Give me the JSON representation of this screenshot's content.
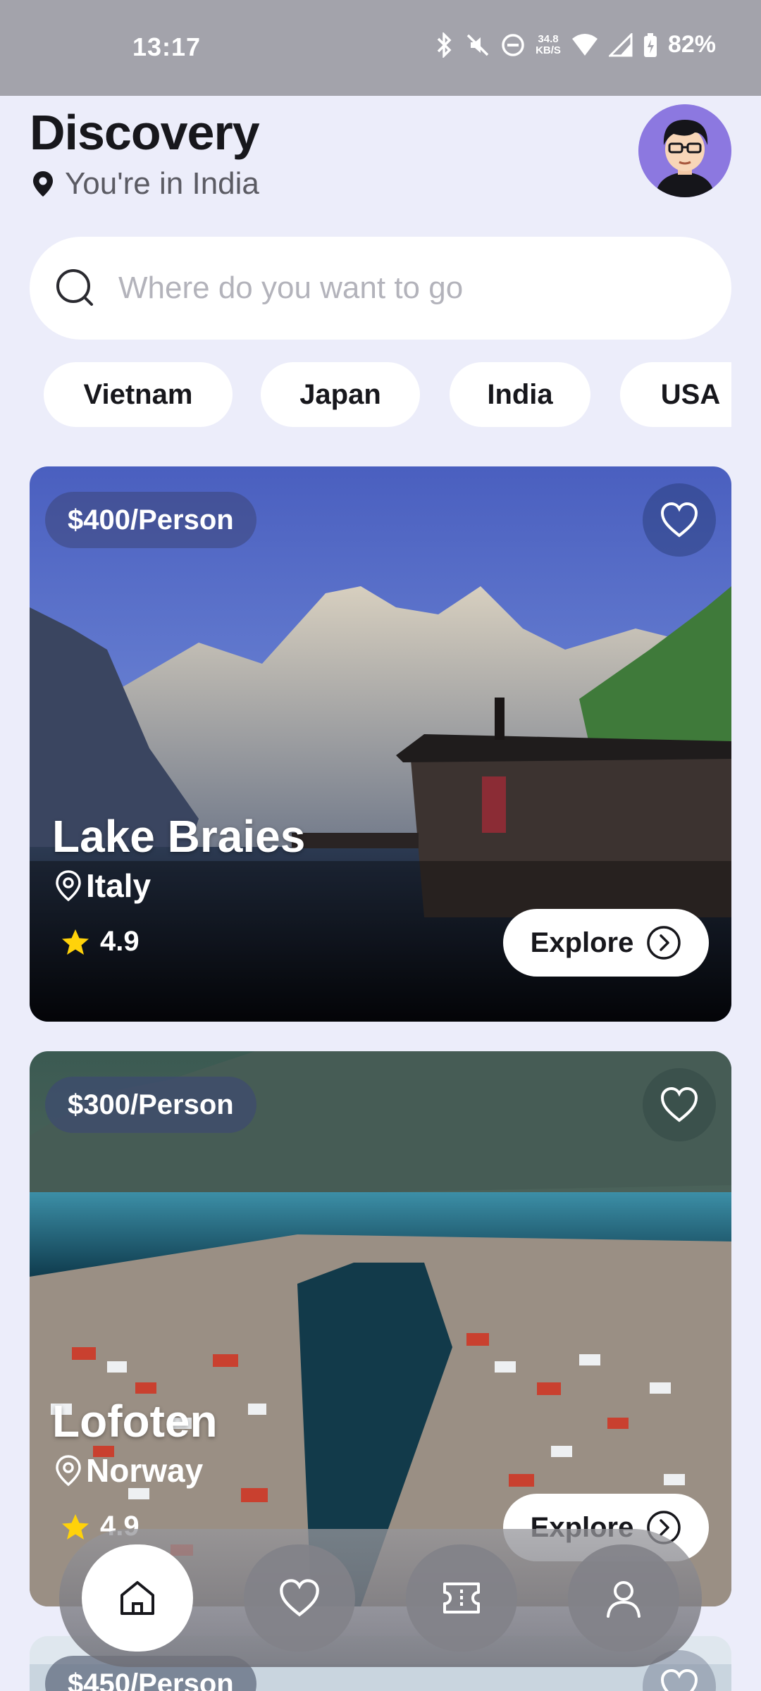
{
  "status_bar": {
    "time": "13:17",
    "net_speed_value": "34.8",
    "net_speed_unit": "KB/S",
    "battery": "82%",
    "icons": [
      "bluetooth-icon",
      "mute-icon",
      "dnd-icon",
      "wifi-icon",
      "signal-icon",
      "battery-icon"
    ]
  },
  "header": {
    "title": "Discovery",
    "location": "You're in India"
  },
  "search": {
    "placeholder": "Where do you want to go"
  },
  "chips": [
    "Vietnam",
    "Japan",
    "India",
    "USA"
  ],
  "cards": [
    {
      "price": "$400/Person",
      "name": "Lake Braies",
      "country": "Italy",
      "rating": "4.9",
      "button": "Explore"
    },
    {
      "price": "$300/Person",
      "name": "Lofoten",
      "country": "Norway",
      "rating": "4.9",
      "button": "Explore"
    },
    {
      "price": "$450/Person"
    }
  ],
  "nav": {
    "items": [
      "home-icon",
      "heart-icon",
      "ticket-icon",
      "profile-icon"
    ],
    "active": "home-icon"
  },
  "colors": {
    "background": "#ECEDFA",
    "status_bar": "#A3A3AB",
    "star": "#FFD20A",
    "avatar_bg": "#8C78E0"
  }
}
